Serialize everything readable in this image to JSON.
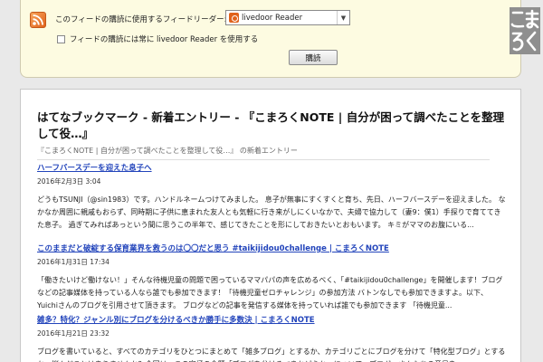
{
  "subscribe": {
    "reader_label": "このフィードの購読に使用するフィードリーダー:",
    "reader_selected": "livedoor Reader",
    "always_label": "フィードの購読には常に livedoor Reader を使用する",
    "subscribe_button": "購読"
  },
  "logo": {
    "text": "こまろく"
  },
  "colors": {
    "link": "#2244bb",
    "panel": "#fdfbe1",
    "rss": "#e0621b"
  },
  "page": {
    "title": "はてなブックマーク - 新着エントリー - 『こまろくNOTE | 自分が困って調べたことを整理して役…』",
    "subtitle": "『こまろくNOTE | 自分が困って調べたことを整理して役…』 の新着エントリー"
  },
  "entries": [
    {
      "title": "ハーフバースデーを迎えた息子へ",
      "date": "2016年2月3日 3:04",
      "body": "どうもTSUNJI（@sin1983）です。ハンドルネームつけてみました。 息子が無事にすくすくと育ち、先日、ハーフバースデーを迎えました。 なかなか周囲に親戚もおらず、同時期に子供に恵まれた友人とも気軽に行き来がしにくいなかで、夫婦で協力して（妻9：僕1）手探りで育ててきた息子。 過ぎてみればあっという間に思うこの半年で、感じてきたことを形にしておきたいとおもいます。 キミがママのお腹にいる..."
    },
    {
      "title": "このままだと破綻する保育業界を救うのは〇〇だと思う #taikijidou0challenge | こまろくNOTE",
      "date": "2016年1月31日 17:34",
      "body": "「働きたいけど働けない！」そんな待機児童の問題で困っているママパパの声を広めるべく、「#taikijidou0challenge」を開催します！ブログなどの記事媒体を持っている人なら誰でも参加できます！「待機児童ゼロチャレンジ」の参加方法 バトンなしでも参加できますよ。以下、Yuichiさんのブログを引用させて頂きます。 ブログなどの記事を発信する媒体を持っていれば誰でも参加できます 「待機児童..."
    },
    {
      "title": "雑多？特化？ジャンル別にブログを分けるべきか勝手に多数決 | こまろくNOTE",
      "date": "2016年1月21日 23:32",
      "body": "ブログを書いていると、すべてのカテゴリをひとつにまとめて「雑多ブログ」とするか、カテゴリごとにブログを分けて「特化型ブログ」とするか、悩んだことはありませんか？今回は、この究極の命題「ブログを分けるべきかどうか」について、ブロガーさんたちの意見を..."
    }
  ]
}
